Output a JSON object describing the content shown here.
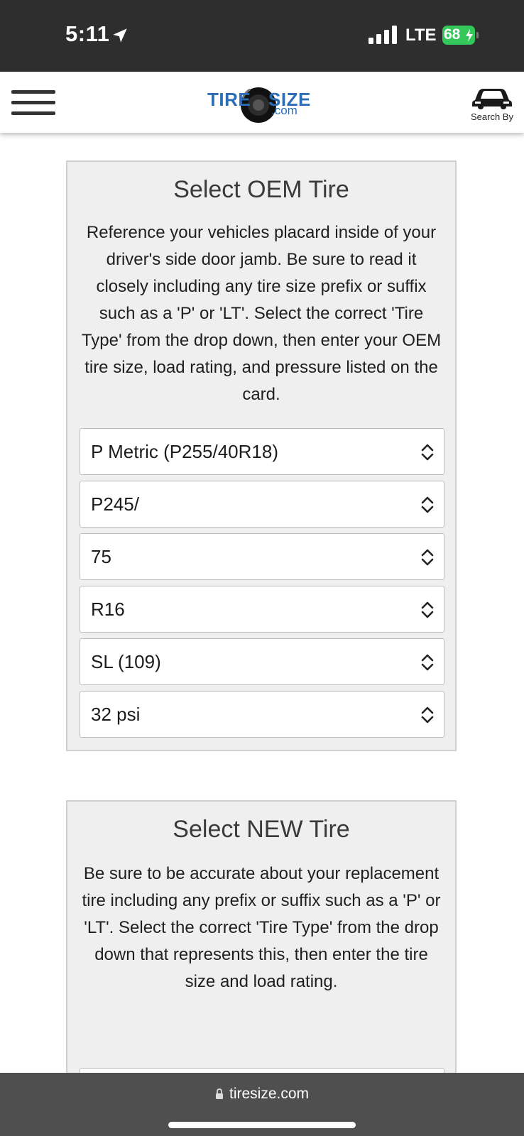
{
  "status_bar": {
    "time": "5:11",
    "network": "LTE",
    "battery": "68"
  },
  "header": {
    "logo_text_left": "TIRE",
    "logo_text_right": "SIZE",
    "logo_suffix": ".com",
    "search_by_label": "Search By"
  },
  "oem_card": {
    "title": "Select OEM Tire",
    "description": "Reference your vehicles placard inside of your driver's side door jamb. Be sure to read it closely including any tire size prefix or suffix such as a 'P' or 'LT'. Select the correct 'Tire Type' from the drop down, then enter your OEM tire size, load rating, and pressure listed on the card.",
    "selects": [
      {
        "name": "tire-type-select",
        "value": "P Metric (P255/40R18)"
      },
      {
        "name": "width-select",
        "value": "P245/"
      },
      {
        "name": "aspect-ratio-select",
        "value": "75"
      },
      {
        "name": "rim-size-select",
        "value": "R16"
      },
      {
        "name": "load-rating-select",
        "value": "SL (109)"
      },
      {
        "name": "pressure-select",
        "value": "32 psi"
      }
    ]
  },
  "new_card": {
    "title": "Select NEW Tire",
    "description": "Be sure to be accurate about your replacement tire including any prefix or suffix such as a 'P' or 'LT'. Select the correct 'Tire Type' from the drop down that represents this, then enter the tire size and load rating."
  },
  "browser_bar": {
    "url": "tiresize.com"
  },
  "colors": {
    "card_bg": "#efefef",
    "logo_blue": "#2c6db5",
    "battery_green": "#34c759"
  }
}
